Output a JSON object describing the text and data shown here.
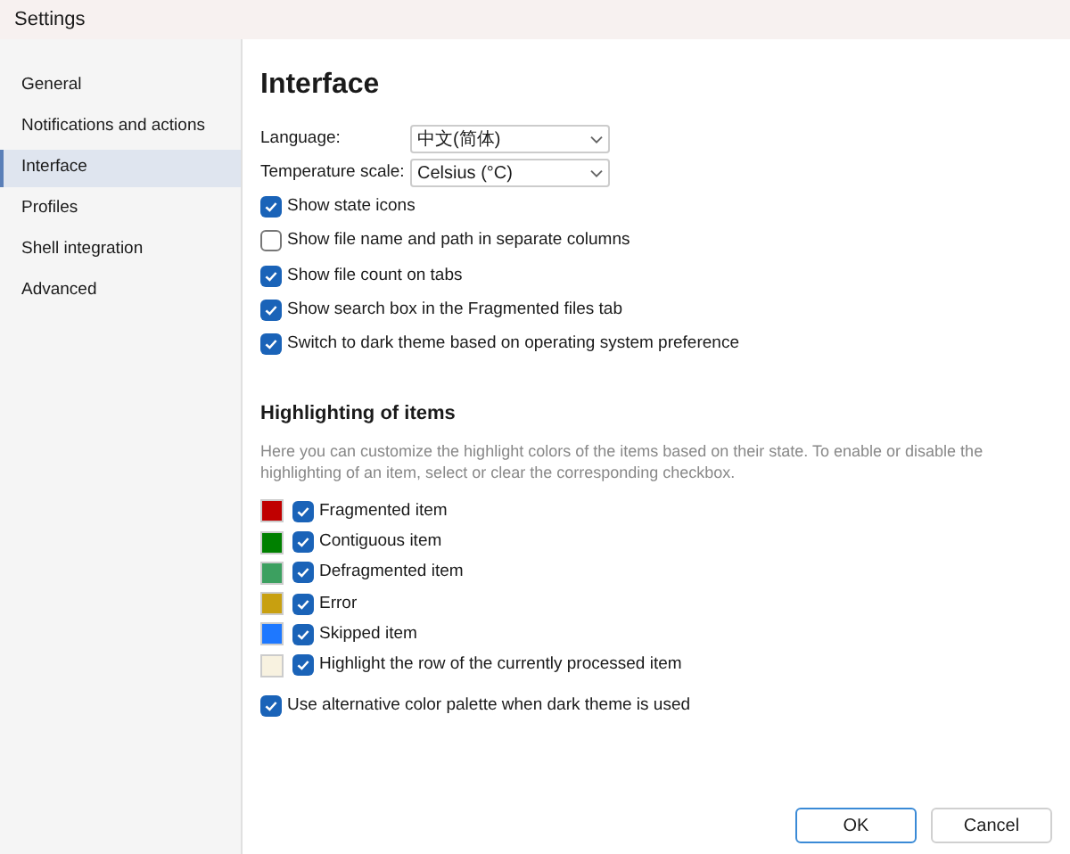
{
  "window": {
    "title": "Settings"
  },
  "sidebar": {
    "items": [
      {
        "label": "General",
        "selected": false
      },
      {
        "label": "Notifications and actions",
        "selected": false
      },
      {
        "label": "Interface",
        "selected": true
      },
      {
        "label": "Profiles",
        "selected": false
      },
      {
        "label": "Shell integration",
        "selected": false
      },
      {
        "label": "Advanced",
        "selected": false
      }
    ]
  },
  "heading": "Interface",
  "fields": [
    {
      "label": "Language:",
      "value": "中文(简体)"
    },
    {
      "label": "Temperature scale:",
      "value": "Celsius (°C)"
    }
  ],
  "options": [
    {
      "label": "Show state icons",
      "checked": true
    },
    {
      "label": "Show file name and path in separate columns",
      "checked": false
    },
    {
      "label": "Show file count on tabs",
      "checked": true
    },
    {
      "label": "Show search box in the Fragmented files tab",
      "checked": true
    },
    {
      "label": "Switch to dark theme based on operating system preference",
      "checked": true
    }
  ],
  "highlighting": {
    "title": "Highlighting of items",
    "description": "Here you can customize the highlight colors of the items based on their state. To enable or disable the highlighting of an item, select or clear the corresponding checkbox.",
    "items": [
      {
        "label": "Fragmented item",
        "color": "#c00000",
        "checked": true
      },
      {
        "label": "Contiguous item",
        "color": "#008000",
        "checked": true
      },
      {
        "label": "Defragmented item",
        "color": "#3ca060",
        "checked": true
      },
      {
        "label": "Error",
        "color": "#c8a010",
        "checked": true
      },
      {
        "label": "Skipped item",
        "color": "#1e78ff",
        "checked": true
      },
      {
        "label": "Highlight the row of the currently processed item",
        "color": "#f8f2e0",
        "checked": true
      }
    ],
    "alternative": {
      "label": "Use alternative color palette when dark theme is used",
      "checked": true
    }
  },
  "buttons": [
    {
      "label": "OK",
      "selected": true
    },
    {
      "label": "Cancel",
      "selected": false
    }
  ]
}
